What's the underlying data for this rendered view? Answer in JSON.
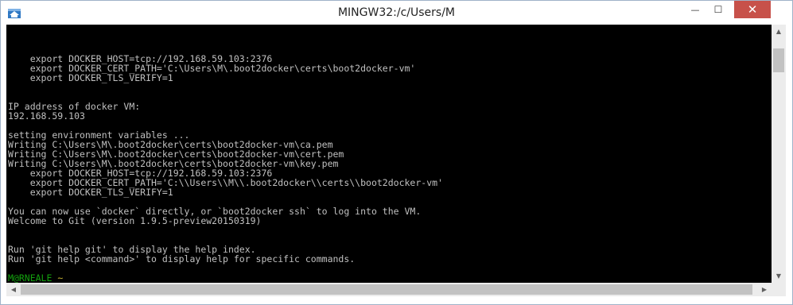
{
  "window": {
    "title": "MINGW32:/c/Users/M",
    "minimize_glyph": "—",
    "maximize_glyph": "☐",
    "close_glyph": "✕"
  },
  "icons": {
    "app": "git-bash-icon",
    "minimize": "minimize-icon",
    "maximize": "maximize-icon",
    "close": "close-icon"
  },
  "terminal": {
    "lines": [
      "    export DOCKER_HOST=tcp://192.168.59.103:2376",
      "    export DOCKER_CERT_PATH='C:\\Users\\M\\.boot2docker\\certs\\boot2docker-vm'",
      "    export DOCKER_TLS_VERIFY=1",
      "",
      "",
      "IP address of docker VM:",
      "192.168.59.103",
      "",
      "setting environment variables ...",
      "Writing C:\\Users\\M\\.boot2docker\\certs\\boot2docker-vm\\ca.pem",
      "Writing C:\\Users\\M\\.boot2docker\\certs\\boot2docker-vm\\cert.pem",
      "Writing C:\\Users\\M\\.boot2docker\\certs\\boot2docker-vm\\key.pem",
      "    export DOCKER_HOST=tcp://192.168.59.103:2376",
      "    export DOCKER_CERT_PATH='C:\\\\Users\\\\M\\\\.boot2docker\\\\certs\\\\boot2docker-vm'",
      "    export DOCKER_TLS_VERIFY=1",
      "",
      "You can now use `docker` directly, or `boot2docker ssh` to log into the VM.",
      "Welcome to Git (version 1.9.5-preview20150319)",
      "",
      "",
      "Run 'git help git' to display the help index.",
      "Run 'git help <command>' to display help for specific commands.",
      ""
    ],
    "prompt_user": "M@RNEALE",
    "prompt_path": "~",
    "prompt_symbol": "$"
  },
  "scrollbars": {
    "up_glyph": "▲",
    "down_glyph": "▼",
    "left_glyph": "◀",
    "right_glyph": "▶"
  },
  "colors": {
    "terminal_bg": "#000000",
    "terminal_fg": "#c0c0c0",
    "prompt_user": "#13a10e",
    "prompt_path": "#c8b432",
    "close_button": "#c7514a"
  }
}
